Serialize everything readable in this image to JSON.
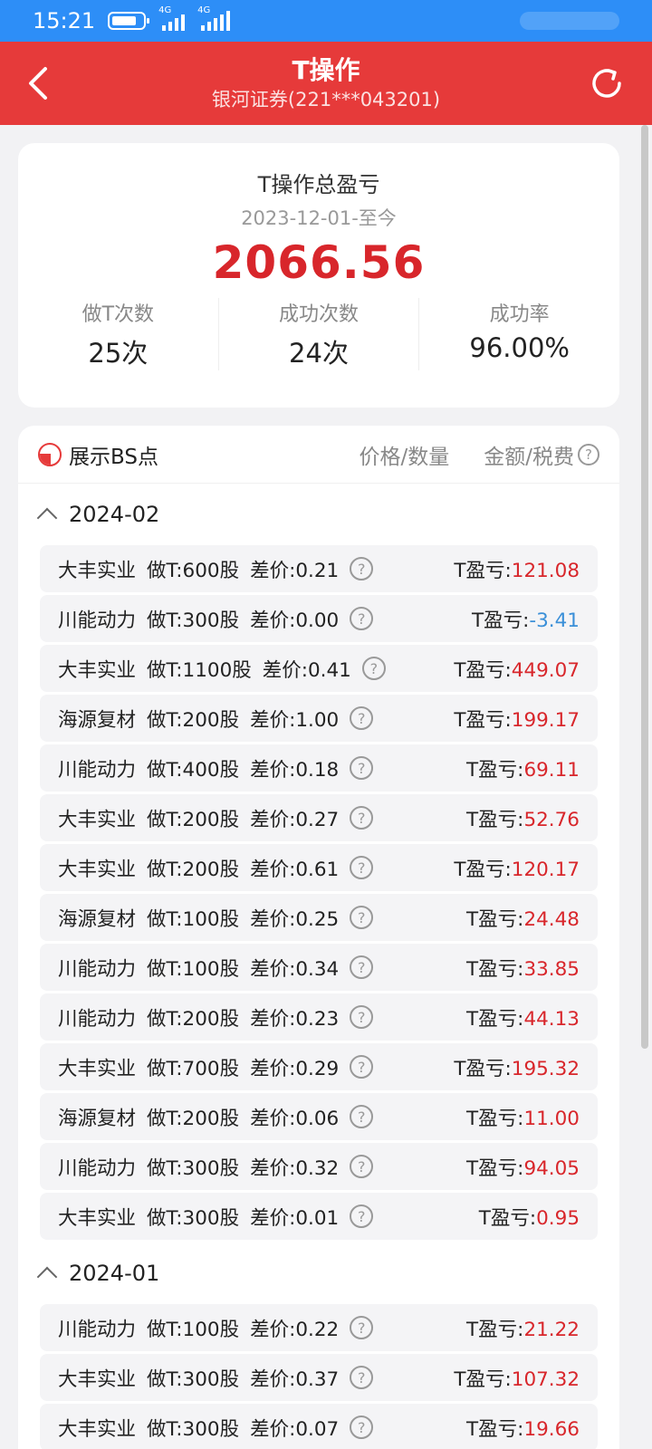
{
  "status": {
    "time": "15:21",
    "net1": "4G",
    "net2": "4G"
  },
  "nav": {
    "title": "T操作",
    "subtitle": "银河证券(221***043201)"
  },
  "summary": {
    "title": "T操作总盈亏",
    "date_range": "2023-12-01-至今",
    "total": "2066.56",
    "stats": [
      {
        "label": "做T次数",
        "value": "25次"
      },
      {
        "label": "成功次数",
        "value": "24次"
      },
      {
        "label": "成功率",
        "value": "96.00%"
      }
    ]
  },
  "list_header": {
    "bs_label": "展示BS点",
    "col1": "价格/数量",
    "col2": "金额/税费"
  },
  "pl_label": "T盈亏:",
  "groups": [
    {
      "month": "2024-02",
      "rows": [
        {
          "name": "大丰实业",
          "qty": "做T:600股",
          "diff": "差价:0.21",
          "pl": "121.08"
        },
        {
          "name": "川能动力",
          "qty": "做T:300股",
          "diff": "差价:0.00",
          "pl": "-3.41"
        },
        {
          "name": "大丰实业",
          "qty": "做T:1100股",
          "diff": "差价:0.41",
          "pl": "449.07"
        },
        {
          "name": "海源复材",
          "qty": "做T:200股",
          "diff": "差价:1.00",
          "pl": "199.17"
        },
        {
          "name": "川能动力",
          "qty": "做T:400股",
          "diff": "差价:0.18",
          "pl": "69.11"
        },
        {
          "name": "大丰实业",
          "qty": "做T:200股",
          "diff": "差价:0.27",
          "pl": "52.76"
        },
        {
          "name": "大丰实业",
          "qty": "做T:200股",
          "diff": "差价:0.61",
          "pl": "120.17"
        },
        {
          "name": "海源复材",
          "qty": "做T:100股",
          "diff": "差价:0.25",
          "pl": "24.48"
        },
        {
          "name": "川能动力",
          "qty": "做T:100股",
          "diff": "差价:0.34",
          "pl": "33.85"
        },
        {
          "name": "川能动力",
          "qty": "做T:200股",
          "diff": "差价:0.23",
          "pl": "44.13"
        },
        {
          "name": "大丰实业",
          "qty": "做T:700股",
          "diff": "差价:0.29",
          "pl": "195.32"
        },
        {
          "name": "海源复材",
          "qty": "做T:200股",
          "diff": "差价:0.06",
          "pl": "11.00"
        },
        {
          "name": "川能动力",
          "qty": "做T:300股",
          "diff": "差价:0.32",
          "pl": "94.05"
        },
        {
          "name": "大丰实业",
          "qty": "做T:300股",
          "diff": "差价:0.01",
          "pl": "0.95"
        }
      ]
    },
    {
      "month": "2024-01",
      "rows": [
        {
          "name": "川能动力",
          "qty": "做T:100股",
          "diff": "差价:0.22",
          "pl": "21.22"
        },
        {
          "name": "大丰实业",
          "qty": "做T:300股",
          "diff": "差价:0.37",
          "pl": "107.32"
        },
        {
          "name": "大丰实业",
          "qty": "做T:300股",
          "diff": "差价:0.07",
          "pl": "19.66"
        }
      ]
    }
  ]
}
